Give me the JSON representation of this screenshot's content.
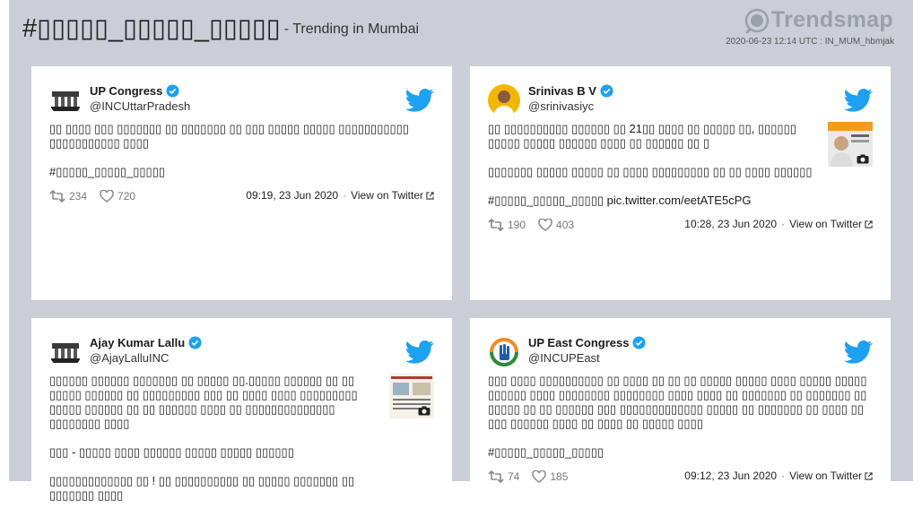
{
  "header": {
    "hashtag": "#▯▯▯▯▯_▯▯▯▯▯_▯▯▯▯▯",
    "subtitle": "- Trending in Mumbai",
    "logo_text": "Trendsmap",
    "timestamp": "2020-06-23 12:14 UTC : IN_MUM_hbmjak"
  },
  "colors": {
    "page_bg": "#cbced6",
    "card_bg": "#ffffff",
    "twitter_blue": "#1da1f2"
  },
  "tweets": [
    {
      "name": "UP Congress",
      "handle": "@INCUttarPradesh",
      "verified": true,
      "avatar_icon": "up-congress-logo",
      "body": [
        "▯▯ ▯▯▯▯ ▯▯▯ ▯▯▯▯▯▯▯ ▯▯ ▯▯▯▯▯▯▯ ▯▯ ▯▯▯ ▯▯▯▯▯ ▯▯▯▯▯ ▯▯▯▯▯▯▯▯▯▯▯ ▯▯▯▯▯▯▯▯▯▯▯ ▯▯▯▯",
        "#▯▯▯▯▯_▯▯▯▯▯_▯▯▯▯▯"
      ],
      "retweets": "234",
      "likes": "720",
      "date": "09:19, 23 Jun 2020",
      "view_label": "View on Twitter"
    },
    {
      "name": "Srinivas B V",
      "handle": "@srinivasiyc",
      "verified": true,
      "avatar_icon": "person-photo",
      "body": [
        "▯▯ ▯▯▯▯▯▯▯▯▯▯ ▯▯▯▯▯▯ ▯▯ 21▯▯ ▯▯▯▯ ▯▯ ▯▯▯▯▯ ▯▯, ▯▯▯▯▯▯ ▯▯▯▯▯ ▯▯▯▯▯ ▯▯▯▯▯▯ ▯▯▯▯ ▯▯ ▯▯▯▯▯▯ ▯▯ ▯",
        "▯▯▯▯▯▯▯ ▯▯▯▯▯ ▯▯▯▯▯ ▯▯ ▯▯▯▯ ▯▯▯▯▯▯▯▯▯ ▯▯ ▯▯ ▯▯▯▯ ▯▯▯▯▯▯",
        "#▯▯▯▯▯_▯▯▯▯▯_▯▯▯▯▯ pic.twitter.com/eetATE5cPG"
      ],
      "retweets": "190",
      "likes": "403",
      "date": "10:28, 23 Jun 2020",
      "view_label": "View on Twitter"
    },
    {
      "name": "Ajay Kumar Lallu",
      "handle": "@AjayLalluINC",
      "verified": true,
      "avatar_icon": "up-congress-logo",
      "body": [
        "▯▯▯▯▯▯ ▯▯▯▯▯▯ ▯▯▯▯▯▯▯ ▯▯ ▯▯▯▯▯ ▯▯.▯▯▯▯▯ ▯▯▯▯▯▯ ▯▯ ▯▯ ▯▯▯▯▯ ▯▯▯▯▯▯ ▯▯ ▯▯▯▯▯▯▯▯▯ ▯▯▯ ▯▯ ▯▯▯▯ ▯▯▯▯ ▯▯▯▯▯▯▯▯▯ ▯▯▯▯▯ ▯▯▯▯▯▯ ▯▯ ▯▯ ▯▯▯▯▯▯ ▯▯▯▯ ▯▯ ▯▯▯▯▯▯▯▯▯▯▯▯▯▯ ▯▯▯▯▯▯▯▯ ▯▯▯▯",
        "▯▯▯ - ▯▯▯▯▯ ▯▯▯▯ ▯▯▯▯▯▯ ▯▯▯▯▯ ▯▯▯▯▯ ▯▯▯▯▯▯",
        "▯▯▯▯▯▯▯▯▯▯▯▯▯ ▯▯ ! ▯▯ ▯▯▯▯▯▯▯▯▯▯ ▯▯ ▯▯▯▯▯ ▯▯▯▯▯▯▯ ▯▯ ▯▯▯▯▯▯▯ ▯▯▯▯"
      ]
    },
    {
      "name": "UP East Congress",
      "handle": "@INCUPEast",
      "verified": true,
      "avatar_icon": "congress-hand-logo",
      "body": [
        "▯▯▯ ▯▯▯▯ ▯▯▯▯▯▯▯▯▯▯ ▯▯ ▯▯▯▯ ▯▯ ▯▯ ▯▯ ▯▯▯▯▯ ▯▯▯▯▯ ▯▯▯▯ ▯▯▯▯▯ ▯▯▯▯▯ ▯▯▯▯▯▯ ▯▯▯▯ ▯▯▯▯▯▯▯▯ ▯▯▯▯▯▯▯▯ ▯▯▯▯ ▯▯▯▯ ▯▯ ▯▯▯▯▯▯▯ ▯▯ ▯▯▯▯▯▯▯ ▯▯ ▯▯▯▯▯ ▯▯ ▯▯ ▯▯▯▯▯▯ ▯▯▯ ▯▯▯▯▯▯▯▯▯▯▯▯▯ ▯▯▯▯▯ ▯▯ ▯▯▯▯▯▯▯ ▯▯ ▯▯▯▯ ▯▯ ▯▯▯ ▯▯▯▯▯▯ ▯▯▯▯ ▯▯ ▯▯▯▯ ▯▯ ▯▯▯▯▯ ▯▯▯▯",
        "#▯▯▯▯▯_▯▯▯▯▯_▯▯▯▯▯"
      ],
      "retweets": "74",
      "likes": "185",
      "date": "09:12, 23 Jun 2020",
      "view_label": "View on Twitter"
    }
  ]
}
